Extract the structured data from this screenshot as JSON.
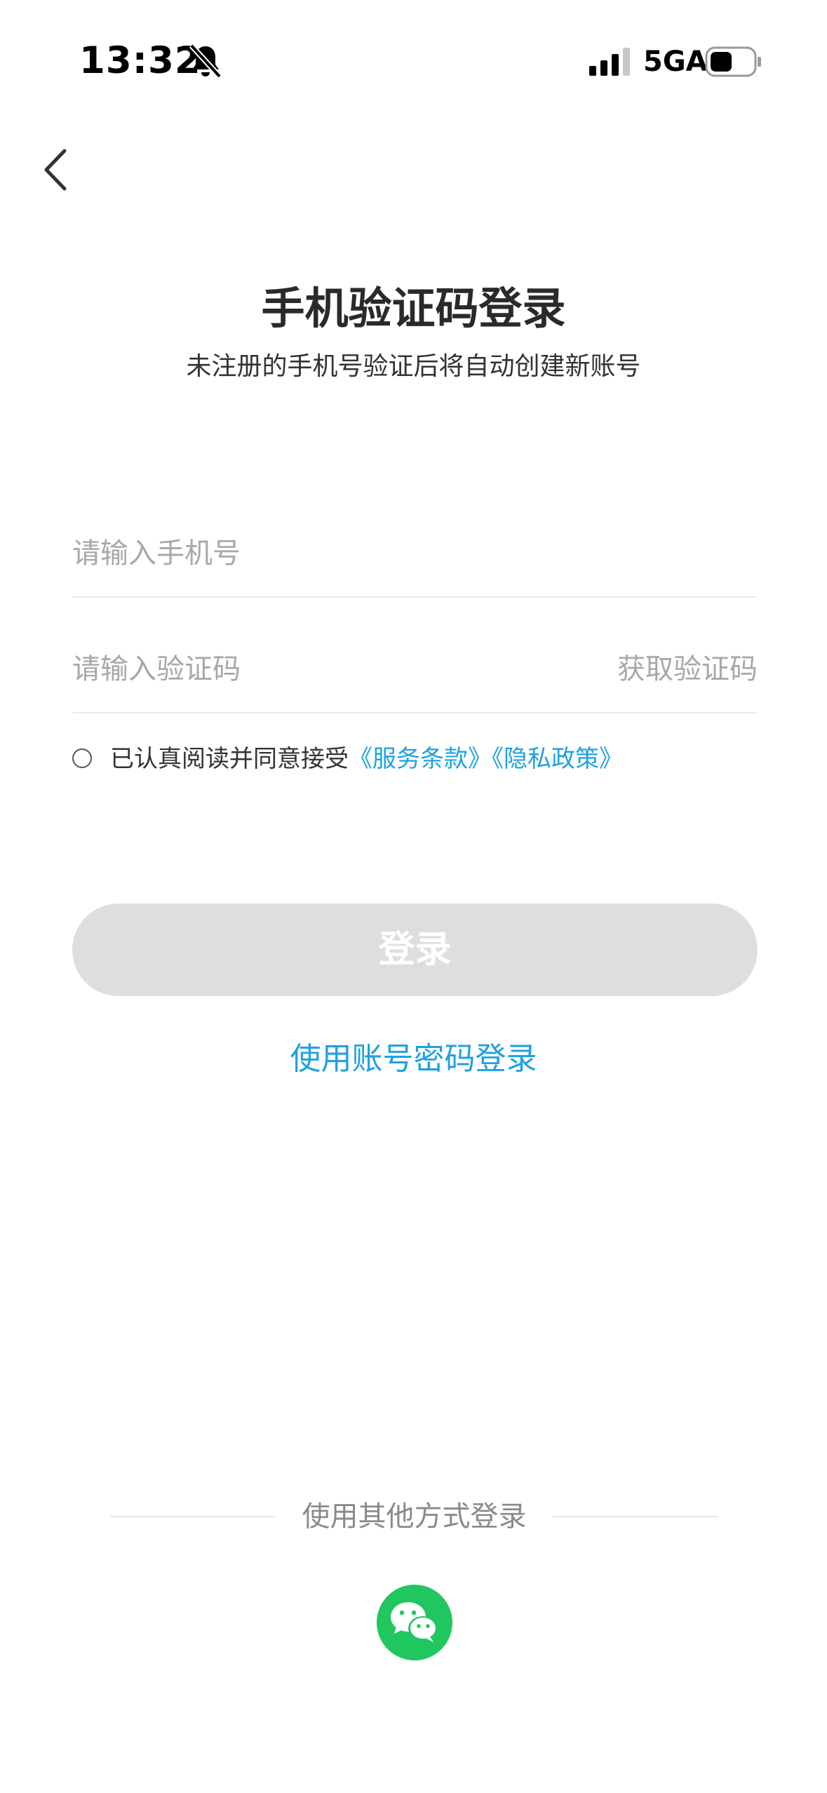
{
  "status_bar": {
    "time": "13:32",
    "network": "5GA",
    "icons": [
      "bell-off-icon",
      "signal-icon",
      "battery-icon"
    ]
  },
  "nav": {
    "back_icon": "chevron-left-icon"
  },
  "header": {
    "title": "手机验证码登录",
    "subtitle": "未注册的手机号验证后将自动创建新账号"
  },
  "form": {
    "phone_placeholder": "请输入手机号",
    "code_placeholder": "请输入验证码",
    "get_code_label": "获取验证码",
    "agreement_prefix": "已认真阅读并同意接受",
    "terms_link": "《服务条款》",
    "privacy_link": "《隐私政策》",
    "login_label": "登录",
    "alt_login_label": "使用账号密码登录"
  },
  "other_methods": {
    "label": "使用其他方式登录",
    "wechat_icon": "wechat-icon"
  },
  "colors": {
    "link": "#1ea1e0",
    "button_disabled": "#dedede",
    "wechat_green": "#1fc75e"
  }
}
